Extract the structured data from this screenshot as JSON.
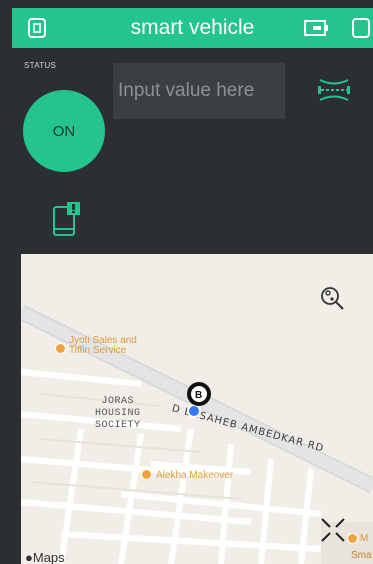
{
  "app": {
    "title": "smart vehicle",
    "accent_color": "#23c48e",
    "background_color": "#2b2f31",
    "icons": [
      "device-icon",
      "battery-icon",
      "square-icon"
    ]
  },
  "controls": {
    "status_label": "STATUS",
    "button_label": "ON",
    "input_placeholder": "Input value here",
    "icons": [
      "resize-icon",
      "phone-notification-icon"
    ]
  },
  "map": {
    "places": [
      {
        "name": "Jyoti Sales and",
        "name_line2": "Tiffin Service"
      },
      {
        "name": "Alekha Makeover"
      }
    ],
    "area_label": [
      "JORAS",
      "HOUSING",
      "SOCIETY"
    ],
    "road_label": "D  BASAHEB AMBEDKAR RD",
    "marker_label": "B",
    "edge_labels": [
      "M",
      "Sma"
    ],
    "provider_label": "Maps",
    "icons": [
      "recenter-icon",
      "expand-icon",
      "location-pin-icon"
    ]
  }
}
